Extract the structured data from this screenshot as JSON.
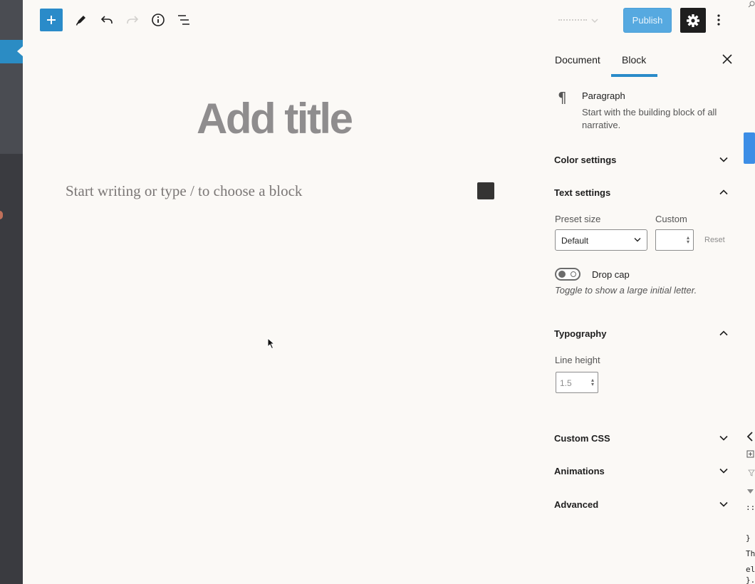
{
  "toolbar": {
    "inserter_icon": "plus-icon",
    "tools_icon": "pencil-icon",
    "undo_icon": "undo-icon",
    "redo_icon": "redo-icon",
    "info_icon": "info-icon",
    "outline_icon": "list-view-icon",
    "publish_label": "Publish",
    "settings_icon": "gear-icon",
    "more_icon": "more-vertical-icon",
    "accent_color": "#2a8bc9",
    "publish_color": "#56a9e0"
  },
  "editor": {
    "title_placeholder": "Add title",
    "block_placeholder": "Start writing or type / to choose a block"
  },
  "sidebar": {
    "tabs": [
      {
        "label": "Document",
        "active": false
      },
      {
        "label": "Block",
        "active": true
      }
    ],
    "close_icon": "close-icon",
    "block_card": {
      "icon": "paragraph-icon",
      "icon_glyph": "¶",
      "title": "Paragraph",
      "description": "Start with the building block of all narrative."
    },
    "panels": {
      "color_settings": {
        "title": "Color settings",
        "open": false
      },
      "text_settings": {
        "title": "Text settings",
        "open": true,
        "preset_size_label": "Preset size",
        "preset_size_value": "Default",
        "custom_label": "Custom",
        "custom_value": "",
        "reset_label": "Reset",
        "drop_cap_label": "Drop cap",
        "drop_cap_enabled": false,
        "drop_cap_help": "Toggle to show a large initial letter."
      },
      "typography": {
        "title": "Typography",
        "open": true,
        "line_height_label": "Line height",
        "line_height_value": "1.5"
      },
      "custom_css": {
        "title": "Custom CSS",
        "open": false
      },
      "animations": {
        "title": "Animations",
        "open": false
      },
      "advanced": {
        "title": "Advanced",
        "open": false
      }
    }
  },
  "devtools": {
    "lines": [
      "::",
      "}",
      "Th",
      "el",
      "}."
    ]
  }
}
